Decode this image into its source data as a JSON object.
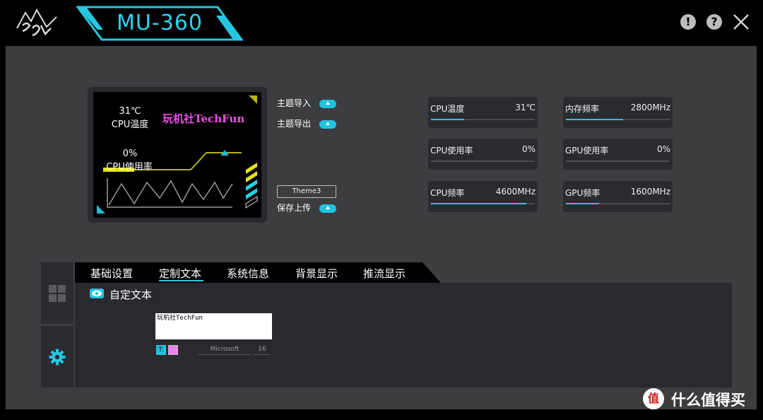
{
  "header": {
    "title": "MU-360",
    "help_symbols": [
      "!",
      "?"
    ],
    "icons": {
      "logo": "mountain-logo-icon",
      "info": "info-icon",
      "help": "help-icon",
      "close": "close-icon"
    }
  },
  "lcd": {
    "temp_value": "31℃",
    "temp_label": "CPU温度",
    "brand": "玩机社TechFun",
    "usage_value": "0%",
    "usage_label": "CPU使用率"
  },
  "theme_actions": {
    "import_label": "主题导入",
    "export_label": "主题导出",
    "theme_name": "Theme3",
    "upload_label": "保存上传"
  },
  "stats": [
    {
      "label": "CPU温度",
      "value": "31℃",
      "level": 0.32
    },
    {
      "label": "内存频率",
      "value": "2800MHz",
      "level": 0.55
    },
    {
      "label": "CPU使用率",
      "value": "0%",
      "level": 0
    },
    {
      "label": "GPU使用率",
      "value": "0%",
      "level": 0
    },
    {
      "label": "CPU频率",
      "value": "4600MHz",
      "level": 0.92
    },
    {
      "label": "GPU频率",
      "value": "1600MHz",
      "level": 0.32
    }
  ],
  "tabs": [
    "基础设置",
    "定制文本",
    "系统信息",
    "背景显示",
    "推流显示"
  ],
  "active_tab": "定制文本",
  "custom_text": {
    "section_title": "自定文本",
    "text_value": "玩机社TechFun",
    "font_icon_label": "T:",
    "font_name": "Microsoft",
    "font_size": "16",
    "text_color": "#f084ee"
  },
  "colors": {
    "accent": "#27c6e0",
    "panel": "#3d3d40",
    "lcd_text_highlight": "#ee4fe9"
  },
  "watermark": {
    "text": "什么值得买",
    "logo_glyph": "值"
  }
}
